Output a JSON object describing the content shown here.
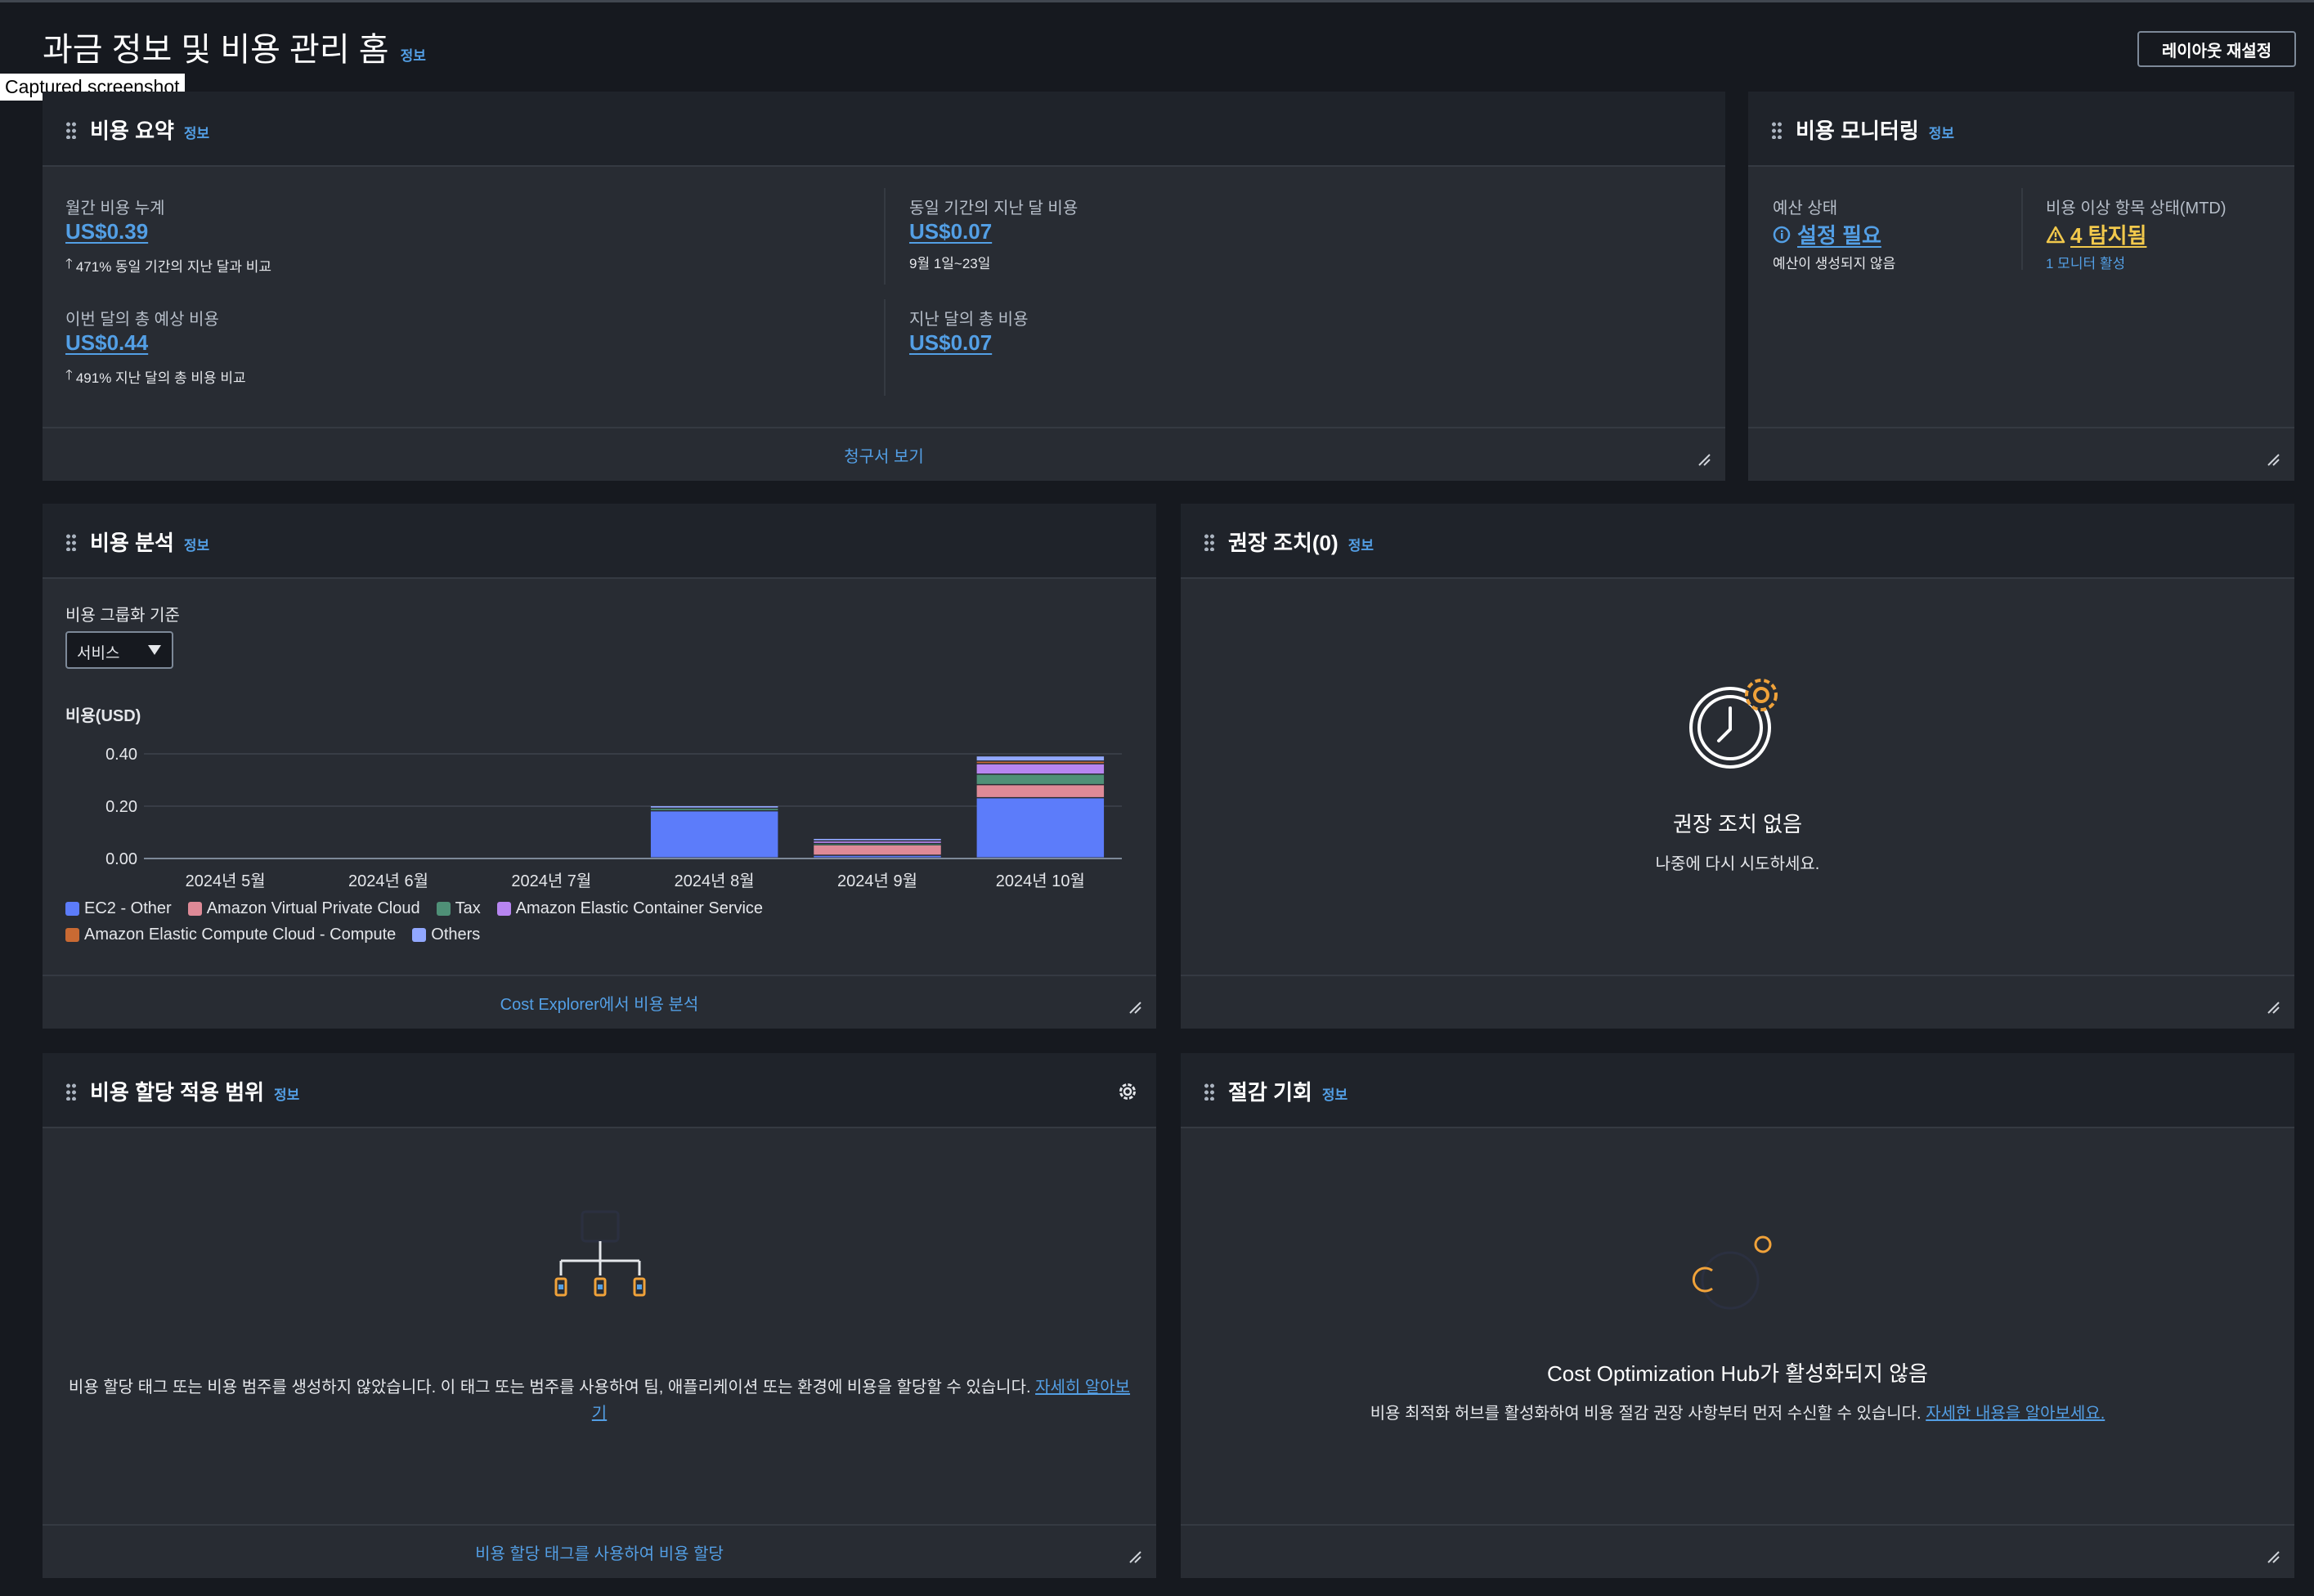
{
  "page": {
    "title": "과금 정보 및 비용 관리 홈",
    "info": "정보",
    "reset_layout": "레이아웃 재설정",
    "captured_label": "Captured screenshot"
  },
  "cost_summary": {
    "title": "비용 요약",
    "info": "정보",
    "mtd_label": "월간 비용 누계",
    "mtd_value": "US$0.39",
    "mtd_note": "471% 동일 기간의 지난 달과 비교",
    "last_same_label": "동일 기간의 지난 달 비용",
    "last_same_value": "US$0.07",
    "last_same_note": "9월 1일~23일",
    "forecast_label": "이번 달의 총 예상 비용",
    "forecast_value": "US$0.44",
    "forecast_note": "491% 지난 달의 총 비용 비교",
    "last_total_label": "지난 달의 총 비용",
    "last_total_value": "US$0.07",
    "footer_link": "청구서 보기"
  },
  "cost_monitor": {
    "title": "비용 모니터링",
    "info": "정보",
    "budget_label": "예산 상태",
    "budget_value": "설정 필요",
    "budget_note": "예산이 생성되지 않음",
    "anomaly_label": "비용 이상 항목 상태(MTD)",
    "anomaly_value": "4 탐지됨",
    "anomaly_note": "1 모니터 활성"
  },
  "cost_analysis": {
    "title": "비용 분석",
    "info": "정보",
    "group_by_label": "비용 그룹화 기준",
    "group_by_value": "서비스",
    "footer_link": "Cost Explorer에서 비용 분석"
  },
  "chart_data": {
    "type": "bar",
    "stacked": true,
    "ylabel": "비용(USD)",
    "ylim": [
      0,
      0.4
    ],
    "yticks": [
      "0.00",
      "0.20",
      "0.40"
    ],
    "categories": [
      "2024년 5월",
      "2024년 6월",
      "2024년 7월",
      "2024년 8월",
      "2024년 9월",
      "2024년 10월"
    ],
    "series": [
      {
        "name": "EC2 - Other",
        "color": "#5c7cfa",
        "values": [
          0,
          0,
          0,
          0.18,
          0.01,
          0.23
        ]
      },
      {
        "name": "Amazon Virtual Private Cloud",
        "color": "#de8a97",
        "values": [
          0,
          0,
          0,
          0,
          0.04,
          0.05
        ]
      },
      {
        "name": "Tax",
        "color": "#4f9077",
        "values": [
          0,
          0,
          0,
          0.01,
          0.005,
          0.04
        ]
      },
      {
        "name": "Amazon Elastic Container Service",
        "color": "#b785f0",
        "values": [
          0,
          0,
          0,
          0,
          0.01,
          0.04
        ]
      },
      {
        "name": "Amazon Elastic Compute Cloud - Compute",
        "color": "#c96a33",
        "values": [
          0,
          0,
          0,
          0,
          0,
          0.01
        ]
      },
      {
        "name": "Others",
        "color": "#92a8ff",
        "values": [
          0,
          0,
          0,
          0.01,
          0.01,
          0.02
        ]
      }
    ],
    "legend_position": "bottom-left",
    "grid": true
  },
  "recommendations": {
    "title": "권장 조치(0)",
    "info": "정보",
    "empty_title": "권장 조치 없음",
    "empty_sub": "나중에 다시 시도하세요."
  },
  "cost_allocation": {
    "title": "비용 할당 적용 범위",
    "info": "정보",
    "message": "비용 할당 태그 또는 비용 범주를 생성하지 않았습니다. 이 태그 또는 범주를 사용하여 팀, 애플리케이션 또는 환경에 비용을 할당할 수 있습니다.",
    "learn_more_1": "자세히 알아보",
    "learn_more_2": "기",
    "footer_link": "비용 할당 태그를 사용하여 비용 할당"
  },
  "savings": {
    "title": "절감 기회",
    "info": "정보",
    "empty_title": "Cost Optimization Hub가 활성화되지 않음",
    "message": "비용 최적화 허브를 활성화하여 비용 절감 권장 사항부터 먼저 수신할 수 있습니다.",
    "learn_more": "자세한 내용을 알아보세요."
  },
  "colors": {
    "background": "#16191f",
    "card": "#282c33",
    "link": "#539fe5",
    "warning": "#f2c94c"
  }
}
